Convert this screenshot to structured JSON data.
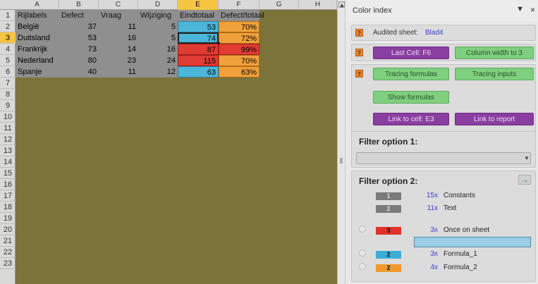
{
  "sheet": {
    "columns": [
      "A",
      "B",
      "C",
      "D",
      "E",
      "F",
      "G",
      "H"
    ],
    "active_column": "E",
    "rows": [
      "1",
      "2",
      "3",
      "4",
      "5",
      "6",
      "7",
      "8",
      "9",
      "10",
      "11",
      "12",
      "13",
      "14",
      "15",
      "16",
      "17",
      "18",
      "19",
      "20",
      "21",
      "22",
      "23"
    ],
    "active_row": "3",
    "headers": [
      "Rijlabels",
      "Defect",
      "Vraag",
      "Wijziging",
      "Eindtotaal",
      "Defect/totaal"
    ],
    "data": [
      [
        "België",
        "37",
        "11",
        "5",
        "53",
        "70%"
      ],
      [
        "Duitsland",
        "53",
        "16",
        "5",
        "74",
        "72%"
      ],
      [
        "Frankrijk",
        "73",
        "14",
        "16",
        "87",
        "99%"
      ],
      [
        "Nederland",
        "80",
        "23",
        "24",
        "115",
        "70%"
      ],
      [
        "Spanje",
        "40",
        "11",
        "12",
        "63",
        "63%"
      ]
    ],
    "background_color": "#7c733a"
  },
  "panel": {
    "title": "Color index",
    "dropdown_glyph": "▼",
    "close_glyph": "×",
    "help_glyph": "?",
    "audited_label": "Audited sheet:",
    "audited_value": "Blad4",
    "buttons": {
      "last_cell": "Last Cell: F6",
      "column_width": "Column width to 3",
      "tracing_formulas": "Tracing formulas",
      "tracing_inputs": "Tracing inputs",
      "show_formulas": "Show formulas",
      "link_to_cell": "Link to cell: E3",
      "link_to_report": "Link to report"
    },
    "filter1": {
      "title": "Filter option 1:",
      "selected": ""
    },
    "filter2": {
      "title": "Filter option 2:",
      "items": [
        {
          "swatch": "1",
          "count": "15x",
          "name": "Constants",
          "color": "#7a7a7a",
          "has_radio": false
        },
        {
          "swatch": "2",
          "count": "11x",
          "name": "Text",
          "color": "#7a7a7a",
          "has_radio": false
        },
        {
          "swatch": "3",
          "count": "3x",
          "name": "Once on sheet",
          "color": "#e0322a",
          "has_radio": true
        },
        {
          "swatch": "2",
          "count": "3x",
          "name": "Formula_1",
          "color": "#3aaed6",
          "has_radio": true
        },
        {
          "swatch": "2",
          "count": "4x",
          "name": "Formula_2",
          "color": "#f09a2f",
          "has_radio": true
        }
      ]
    }
  }
}
